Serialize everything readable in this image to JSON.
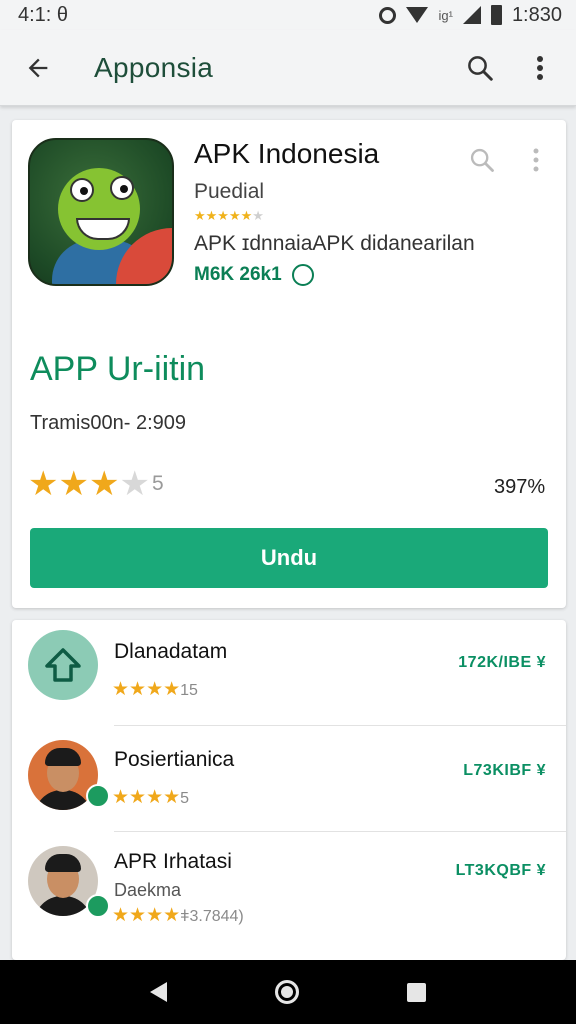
{
  "status_bar": {
    "time_left": "4:1: θ",
    "tiny_label": "ig¹",
    "time_right": "1:830"
  },
  "app_bar": {
    "title": "Apponsia",
    "back_icon": "arrow-back-icon",
    "search_icon": "search-icon",
    "more_icon": "more-vert-icon"
  },
  "app_card": {
    "name": "APK Indonesia",
    "developer": "Puedial",
    "small_rating_stars": 5,
    "description": "APK ɪdnnaiaAPK didanearilan",
    "size": "M6K 26k1",
    "section_title": "APP Ur-iitin",
    "downloads": "Tramis00n-  2:909",
    "rating_value": "5",
    "rating_stars_filled": 3,
    "rating_percent": "397%",
    "install_label": "Undu",
    "colors": {
      "accent": "#1aa979",
      "title_green": "#0e8c5c",
      "star": "#f0a81b"
    }
  },
  "list": {
    "items": [
      {
        "title": "Dlanadatam",
        "subtitle": "",
        "rating_text": "15",
        "stars": "★★★★",
        "size": "172K/IBE ¥",
        "avatar": "home-icon"
      },
      {
        "title": "Posiertianica",
        "subtitle": "",
        "rating_text": "5",
        "stars": "★★★★",
        "size": "L73KIBF ¥",
        "avatar": "person-avatar"
      },
      {
        "title": "APR Irhatasi",
        "subtitle": "Daekma",
        "rating_text": "ǂ3.7844)",
        "stars": "★★★★",
        "size": "LT3KQBF ¥",
        "avatar": "person-avatar"
      }
    ]
  },
  "nav_bar": {
    "back": "nav-back-icon",
    "home": "nav-home-icon",
    "recent": "nav-recent-icon"
  }
}
